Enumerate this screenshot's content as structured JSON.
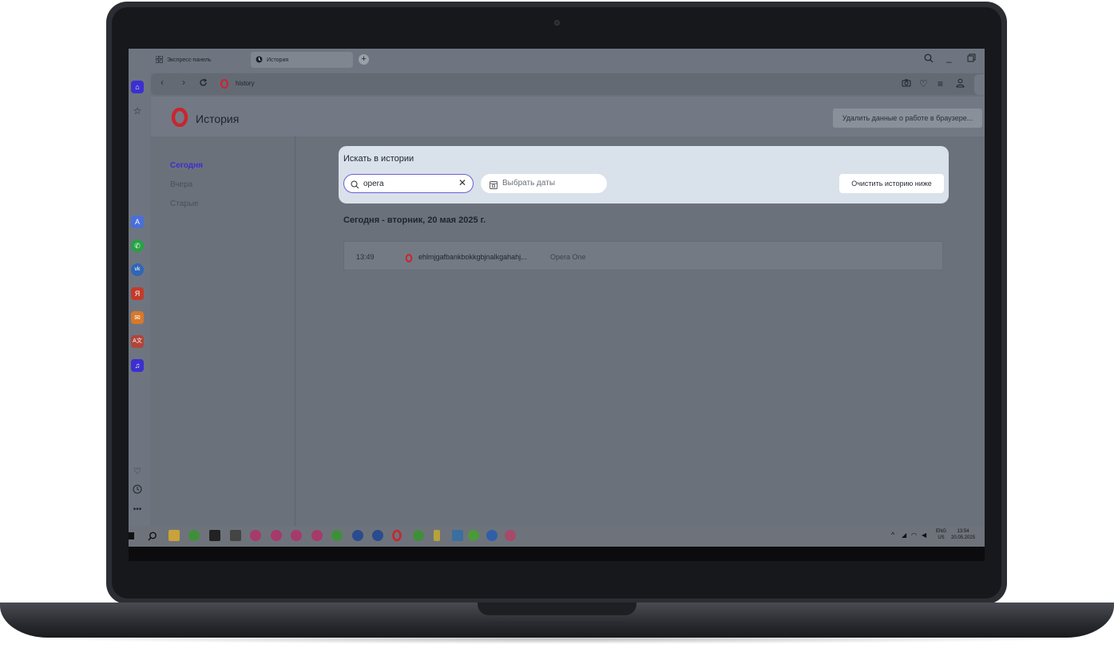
{
  "tabs": [
    {
      "label": "Экспресс-панель",
      "icon": "grid-icon"
    },
    {
      "label": "История",
      "icon": "clock-icon"
    }
  ],
  "address": {
    "url": "history"
  },
  "page": {
    "title": "История",
    "delete_data_button": "Удалить данные о работе в браузере..."
  },
  "nav": {
    "items": [
      "Сегодня",
      "Вчера",
      "Старые"
    ],
    "active": "Сегодня"
  },
  "search": {
    "heading": "Искать в истории",
    "value": "opera",
    "date_placeholder": "Выбрать даты",
    "clear_button": "Очистить историю ниже"
  },
  "history": {
    "date_heading": "Сегодня - вторник, 20 мая 2025 г.",
    "entries": [
      {
        "time": "13:49",
        "title": "ehlmjgafbankbokkgbjnalkgahahj...",
        "site": "Opera One"
      }
    ]
  },
  "taskbar": {
    "lang": "ENG",
    "region": "US",
    "time": "13:54",
    "date": "20.05.2025"
  },
  "colors": {
    "accent": "#3b2fd0",
    "opera_red": "#d2202e"
  }
}
